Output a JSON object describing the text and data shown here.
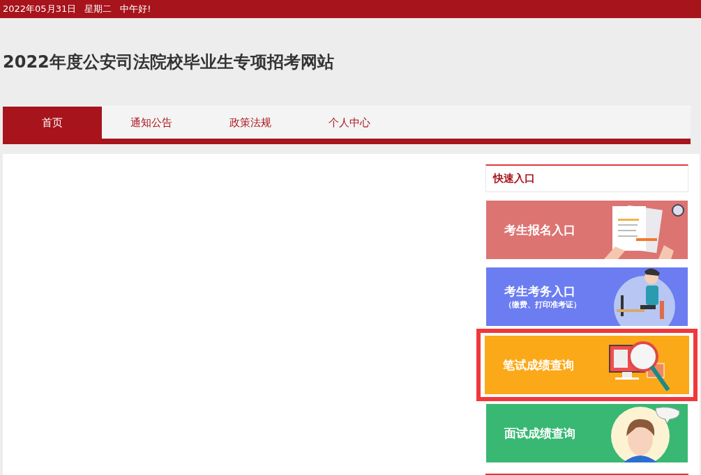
{
  "top_bar": {
    "date": "2022年05月31日",
    "weekday": "星期二",
    "greeting": "中午好!"
  },
  "header": {
    "title": "2022年度公安司法院校毕业生专项招考网站"
  },
  "nav": [
    {
      "label": "首页",
      "selected": true
    },
    {
      "label": "通知公告",
      "selected": false
    },
    {
      "label": "政策法规",
      "selected": false
    },
    {
      "label": "个人中心",
      "selected": false
    }
  ],
  "quick_entry": {
    "title": "快速入口",
    "banners": [
      {
        "kind": "register",
        "title": "考生报名入口",
        "color": "#dc7472",
        "highlighted": false
      },
      {
        "kind": "exam",
        "title": "考生考务入口",
        "subtitle": "（缴费、打印准考证）",
        "color": "#6b7df0",
        "highlighted": false
      },
      {
        "kind": "written",
        "title": "笔试成绩查询",
        "color": "#fba918",
        "highlighted": true
      },
      {
        "kind": "interview",
        "title": "面试成绩查询",
        "color": "#38b872",
        "highlighted": false
      }
    ]
  }
}
